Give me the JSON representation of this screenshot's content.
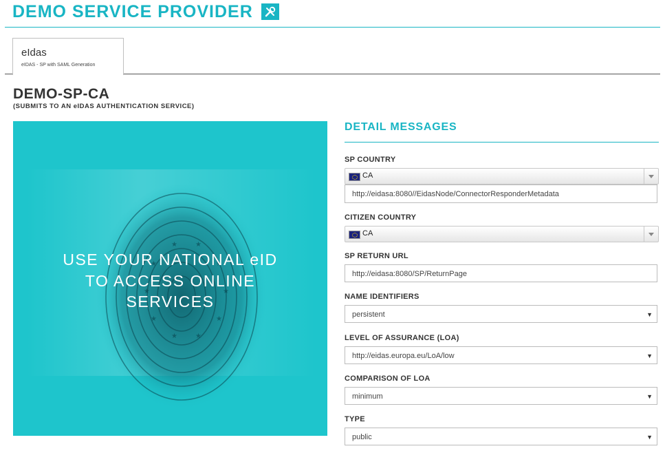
{
  "header": {
    "title": "DEMO SERVICE PROVIDER",
    "icon": "tools-icon",
    "accent": "#19b5c4"
  },
  "tab": {
    "title": "eIdas",
    "subtitle": "eIDAS - SP with SAML Generation"
  },
  "page": {
    "title": "DEMO-SP-CA",
    "subtitle": "(SUBMITS TO AN eIDAS AUTHENTICATION SERVICE)"
  },
  "hero": {
    "line1": "USE YOUR NATIONAL eID",
    "line2": "TO ACCESS ONLINE",
    "line3": "SERVICES",
    "background": "#1ec5cc"
  },
  "detail": {
    "title": "DETAIL MESSAGES",
    "sp_country": {
      "label": "SP COUNTRY",
      "value": "CA",
      "icon": "eu-flag-icon"
    },
    "metadata_url": {
      "value": "http://eidasa:8080//EidasNode/ConnectorResponderMetadata"
    },
    "citizen_country": {
      "label": "CITIZEN COUNTRY",
      "value": "CA",
      "icon": "eu-flag-icon"
    },
    "return_url": {
      "label": "SP RETURN URL",
      "value": "http://eidasa:8080/SP/ReturnPage"
    },
    "name_identifiers": {
      "label": "NAME IDENTIFIERS",
      "value": "persistent"
    },
    "loa": {
      "label": "LEVEL OF ASSURANCE (LOA)",
      "value": "http://eidas.europa.eu/LoA/low"
    },
    "comparison": {
      "label": "COMPARISON OF LOA",
      "value": "minimum"
    },
    "type": {
      "label": "TYPE",
      "value": "public"
    }
  }
}
